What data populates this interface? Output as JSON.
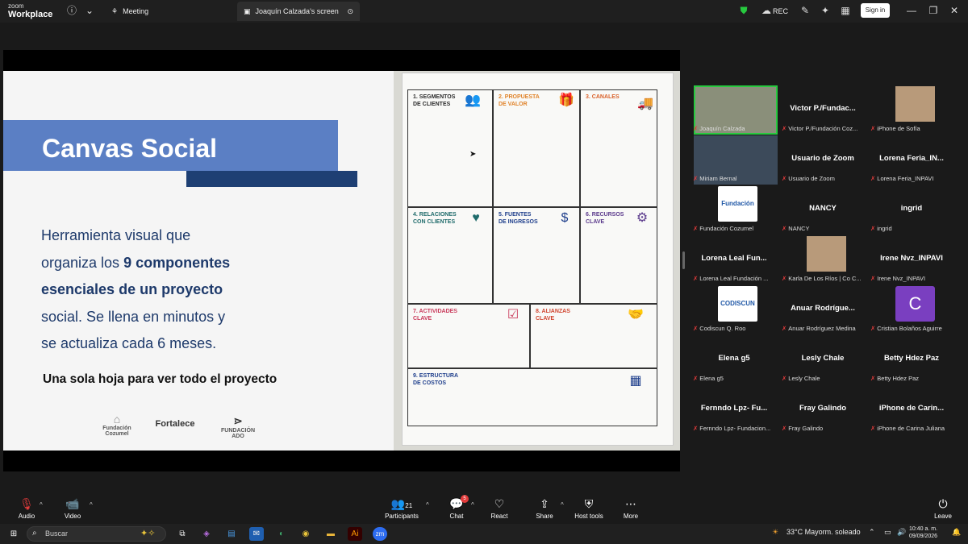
{
  "app": {
    "brand_top": "zoom",
    "brand_bottom": "Workplace"
  },
  "tabs": [
    {
      "label": "Meeting"
    },
    {
      "label": "Joaquín Calzada's screen"
    }
  ],
  "toolbar": {
    "rec_label": "REC",
    "signin_label": "Sign in"
  },
  "slide": {
    "title": "Canvas Social",
    "body_line1": "Herramienta visual que",
    "body_line2_pre": "organiza los ",
    "body_line2_bold": "9 componentes",
    "body_line3_bold": "esenciales de un proyecto",
    "body_line4": "social. Se llena en minutos y",
    "body_line5": "se actualiza cada 6 meses.",
    "tagline": "Una sola  hoja para ver todo el proyecto",
    "logos": [
      "Fundación Cozumel",
      "Fortalece",
      "FUNDACIÓN ADO"
    ]
  },
  "canvas_board": {
    "cells": [
      {
        "label": "1. SEGMENTOS\nDE CLIENTES",
        "icon": "people-icon",
        "color": "#2b2b2b"
      },
      {
        "label": "2. PROPUESTA\nDE VALOR",
        "icon": "gift-icon",
        "color": "#e0832a"
      },
      {
        "label": "3. CANALES",
        "icon": "truck-icon",
        "color": "#d9612a"
      },
      {
        "label": "4. RELACIONES\nCON CLIENTES",
        "icon": "heart-icon",
        "color": "#1f6b6b"
      },
      {
        "label": "5. FUENTES\nDE INGRESOS",
        "icon": "dollar-icon",
        "color": "#1f3f8c"
      },
      {
        "label": "6. RECURSOS\nCLAVE",
        "icon": "gear-icon",
        "color": "#5b3a8c"
      },
      {
        "label": "7. ACTIVIDADES\nCLAVE",
        "icon": "checklist-icon",
        "color": "#c93a5a"
      },
      {
        "label": "8. ALIANZAS\nCLAVE",
        "icon": "handshake-icon",
        "color": "#d0452f"
      },
      {
        "label": "9. ESTRUCTURA\nDE COSTOS",
        "icon": "calculator-icon",
        "color": "#1f3f8c"
      }
    ]
  },
  "participants": [
    {
      "name": "",
      "sub": "Joaquín Calzada",
      "kind": "video"
    },
    {
      "name": "Victor  P./Fundac...",
      "sub": "Victor P./Fundación Coz...",
      "kind": "name"
    },
    {
      "name": "",
      "sub": "iPhone de Sofía",
      "kind": "video-small"
    },
    {
      "name": "",
      "sub": "Miriam Bernal",
      "kind": "video"
    },
    {
      "name": "Usuario de Zoom",
      "sub": "Usuario de Zoom",
      "kind": "name"
    },
    {
      "name": "Lorena  Feria_IN...",
      "sub": "Lorena Feria_INPAVI",
      "kind": "name"
    },
    {
      "name": "",
      "sub": "Fundación Cozumel",
      "kind": "logo",
      "logo": "Fundación"
    },
    {
      "name": "NANCY",
      "sub": "NANCY",
      "kind": "name"
    },
    {
      "name": "ingrid",
      "sub": "ingrid",
      "kind": "name"
    },
    {
      "name": "Lorena Leal  Fun...",
      "sub": "Lorena Leal Fundación ...",
      "kind": "name"
    },
    {
      "name": "",
      "sub": "Karla De Los Ríos | Co C...",
      "kind": "video-small"
    },
    {
      "name": "Irene  Nvz_INPAVI",
      "sub": "Irene Nvz_INPAVI",
      "kind": "name"
    },
    {
      "name": "",
      "sub": "Codiscun Q. Roo",
      "kind": "logo",
      "logo": "CODISCUN"
    },
    {
      "name": "Anuar  Rodrígue...",
      "sub": "Anuar Rodríguez Medina",
      "kind": "name"
    },
    {
      "name": "",
      "sub": "Cristian Bolaños Aguirre",
      "kind": "avatar",
      "logo": "C"
    },
    {
      "name": "Elena g5",
      "sub": "Elena g5",
      "kind": "name"
    },
    {
      "name": "Lesly Chale",
      "sub": "Lesly Chale",
      "kind": "name"
    },
    {
      "name": "Betty Hdez Paz",
      "sub": "Betty Hdez Paz",
      "kind": "name"
    },
    {
      "name": "Fernndo  Lpz-  Fu...",
      "sub": "Fernndo Lpz- Fundacion...",
      "kind": "name"
    },
    {
      "name": "Fray Galindo",
      "sub": "Fray Galindo",
      "kind": "name"
    },
    {
      "name": "iPhone  de  Carin...",
      "sub": "iPhone de Carina Juliana",
      "kind": "name"
    }
  ],
  "controls": {
    "audio": "Audio",
    "video": "Video",
    "participants": "Participants",
    "participants_count": "21",
    "chat": "Chat",
    "chat_badge": "5",
    "react": "React",
    "share": "Share",
    "host_tools": "Host tools",
    "more": "More",
    "leave": "Leave"
  },
  "taskbar": {
    "search_placeholder": "Buscar",
    "weather": "33°C  Mayorm. soleado",
    "time": "10:40 a. m.",
    "date": "09/09/2026"
  },
  "colors": {
    "accent_blue": "#5b7fc4",
    "dark_blue": "#1e3f73",
    "mute_red": "#e23b3b",
    "active_green": "#27c93f"
  }
}
